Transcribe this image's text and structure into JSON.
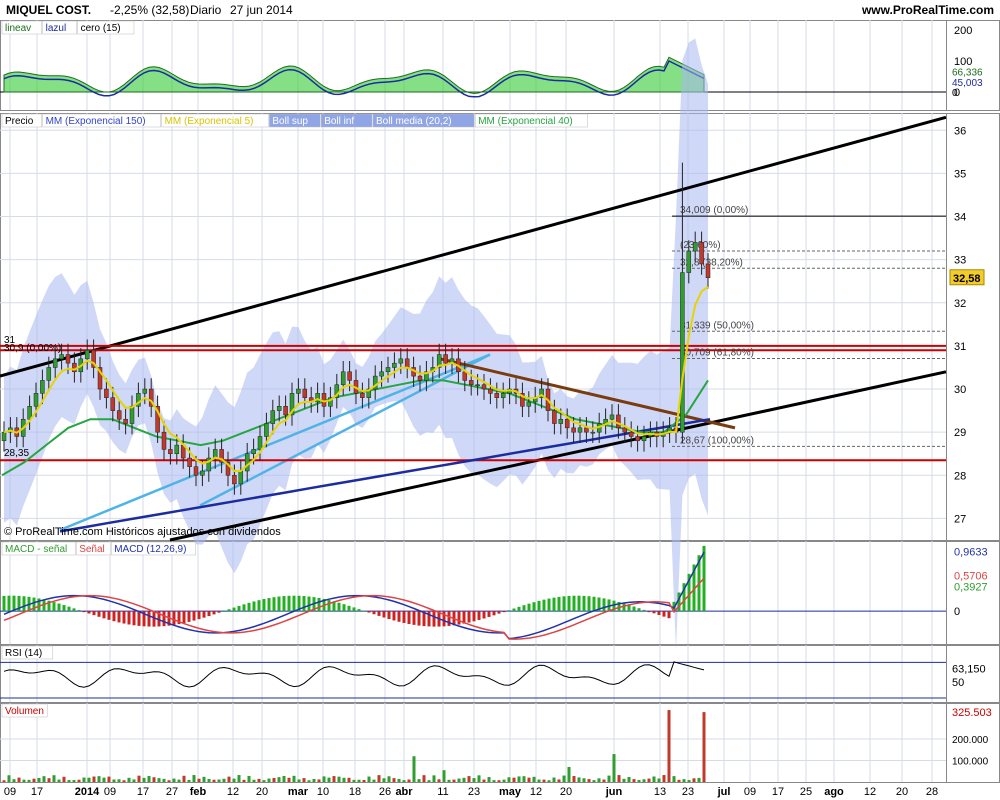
{
  "header": {
    "title": "MIQUEL COST.",
    "change": "-2,25% (32,58)",
    "period": "Diario",
    "date": "27 jun 2014",
    "site": "www.ProRealTime.com"
  },
  "copyright": "© ProRealTime.com  Históricos ajustados con dividendos",
  "colors": {
    "grid": "#d6dce6",
    "axis_bg": "#ffffff",
    "up_candle": "#2f9e2f",
    "down_candle": "#c0392b",
    "black": "#000000",
    "red_line": "#cc0000",
    "brown_line": "#7a3b0f",
    "light_blue": "#4fb3e8",
    "navy": "#1c2ca0",
    "green_ma": "#26a641",
    "yellow_ma": "#e6d400",
    "boll_fill": "#a9b8f0",
    "macd_line": "#2233aa",
    "signal_line": "#dd4444",
    "hist_up": "#22b022",
    "hist_down": "#cc2222",
    "osc_fill": "#33cc33"
  },
  "x_axis": {
    "ticks": [
      "09",
      "17",
      "2014",
      "09",
      "17",
      "27",
      "feb",
      "12",
      "20",
      "mar",
      "10",
      "18",
      "26",
      "abr",
      "11",
      "23",
      "may",
      "12",
      "20",
      "jun",
      "13",
      "23",
      "jul",
      "09",
      "17",
      "25",
      "ago",
      "12",
      "20",
      "28"
    ]
  },
  "panels": {
    "oscillator": {
      "legend": [
        {
          "label": "lineav",
          "color": "#1c6d1c"
        },
        {
          "label": "lazul",
          "color": "#1c2ca0"
        },
        {
          "label": "cero (15)",
          "color": "#000000"
        }
      ],
      "axis_labels": [
        "200",
        "100",
        "0"
      ],
      "value_tags": [
        {
          "label": "66,336",
          "color": "#1c6d1c"
        },
        {
          "label": "45,003",
          "color": "#1c2ca0"
        },
        {
          "label": "0",
          "color": "#000000"
        }
      ]
    },
    "price": {
      "legend": [
        {
          "label": "Precio",
          "color": "#000000",
          "bg": "#ffffff"
        },
        {
          "label": "MM (Exponencial 150)",
          "color": "#3344cc",
          "bg": "#ffffff"
        },
        {
          "label": "MM (Exponencial 5)",
          "color": "#d8c400",
          "bg": "#ffffff"
        },
        {
          "label": "Boll sup",
          "color": "#ffffff",
          "bg": "#8fa5e6"
        },
        {
          "label": "Boll inf",
          "color": "#ffffff",
          "bg": "#8fa5e6"
        },
        {
          "label": "Boll media (20,2)",
          "color": "#ffffff",
          "bg": "#8fa5e6"
        },
        {
          "label": "MM (Exponencial 40)",
          "color": "#26a641",
          "bg": "#ffffff"
        }
      ],
      "axis_labels": [
        "36",
        "35",
        "34",
        "33",
        "32",
        "31",
        "30",
        "29",
        "28",
        "27"
      ],
      "last_price_tag": "32,58",
      "line_labels": [
        {
          "label": "31",
          "kind": "resistance"
        },
        {
          "label": "30,9 (0,00%)",
          "kind": "fib"
        },
        {
          "label": "28,35",
          "kind": "support"
        }
      ],
      "fibonacci": [
        {
          "label": "34,009 (0,00%)"
        },
        {
          "label": "(23,60%)"
        },
        {
          "label": "32,8 (38,20%)"
        },
        {
          "label": "31,339 (50,00%)"
        },
        {
          "label": "30,709 (61,80%)"
        },
        {
          "label": "28,67 (100,00%)"
        }
      ]
    },
    "macd": {
      "legend": [
        {
          "label": "MACD - señal",
          "color": "#2f9e2f"
        },
        {
          "label": "Señal",
          "color": "#dd4444"
        },
        {
          "label": "MACD (12,26,9)",
          "color": "#2233aa"
        }
      ],
      "value_tags": [
        {
          "label": "0,9633",
          "color": "#2233aa"
        },
        {
          "label": "0,5706",
          "color": "#dd4444"
        },
        {
          "label": "0,3927",
          "color": "#2f9e2f"
        },
        {
          "label": "0",
          "color": "#000000"
        }
      ]
    },
    "rsi": {
      "legend": [
        {
          "label": "RSI (14)",
          "color": "#000000"
        }
      ],
      "value_tags": [
        {
          "label": "63,150",
          "color": "#000000"
        },
        {
          "label": "50",
          "color": "#000000"
        }
      ]
    },
    "volume": {
      "legend": [
        {
          "label": "Volumen",
          "color": "#cc0000"
        }
      ],
      "axis_labels": [
        "200.000",
        "100.000"
      ],
      "value_tag": "325.503"
    }
  },
  "chart_data": {
    "type": "candlestick",
    "title": "MIQUEL COST.",
    "period": "Diario",
    "ylim": [
      26.5,
      36.4
    ],
    "close_series": [
      29,
      29.1,
      28.9,
      29.3,
      29.6,
      29.9,
      30.2,
      30.5,
      30.7,
      30.8,
      30.6,
      30.4,
      30.7,
      30.9,
      30.5,
      30,
      29.8,
      29.5,
      29.3,
      29.2,
      29.6,
      29.9,
      30,
      29.6,
      29,
      28.6,
      28.5,
      28.7,
      28.4,
      28.2,
      28,
      28.1,
      28.4,
      28.6,
      28.3,
      28,
      27.8,
      28.1,
      28.5,
      28.6,
      28.9,
      29.2,
      29.5,
      29.6,
      29.4,
      29.9,
      30,
      29.8,
      29.7,
      29.9,
      29.6,
      29.8,
      30.1,
      30.4,
      30.2,
      29.9,
      29.8,
      30,
      30.3,
      30.4,
      30.5,
      30.6,
      30.7,
      30.5,
      30.3,
      30.2,
      30.4,
      30.5,
      30.8,
      30.6,
      30.7,
      30.4,
      30.2,
      30.1,
      30.1,
      30,
      29.9,
      29.8,
      29.9,
      30,
      29.9,
      29.6,
      29.7,
      29.8,
      30,
      29.5,
      29.2,
      29.3,
      29.1,
      29,
      29.1,
      29,
      29,
      29.2,
      29.3,
      29.4,
      29.1,
      29,
      28.9,
      28.8,
      28.9,
      29,
      28.9,
      29,
      29.1,
      29,
      32.7,
      33.2,
      33.4,
      32.9,
      32.58
    ],
    "exp_ma_150": [
      26.7,
      26.8,
      26.9,
      27,
      27.1,
      27.2,
      27.3,
      27.4,
      27.5,
      27.6,
      27.7,
      27.8,
      27.9,
      28,
      28.1,
      28.2,
      28.3,
      28.4,
      28.5,
      28.6,
      28.7,
      28.8,
      28.9,
      29,
      29.1,
      29.2,
      29.3
    ],
    "exp_ma_40": [
      28,
      28.3,
      28.7,
      29.1,
      29.3,
      29.3,
      29.1,
      28.9,
      28.8,
      28.7,
      28.8,
      29,
      29.2,
      29.4,
      29.6,
      29.8,
      29.9,
      30,
      30.1,
      30.2,
      30.2,
      30.1,
      30,
      29.9,
      29.7,
      29.5,
      29.3,
      29.2,
      29.1,
      29,
      29,
      29.4,
      30.2
    ],
    "horizontal_lines": [
      31,
      30.9,
      28.35
    ],
    "fibonacci_levels": [
      34.009,
      33.2,
      32.8,
      31.339,
      30.709,
      28.67
    ],
    "volume_last": 325503,
    "rsi_last": 63.15,
    "macd": {
      "macd": 0.9633,
      "signal": 0.5706,
      "histogram": 0.3927
    },
    "oscillator_last": {
      "lineav": 66.336,
      "lazul": 45.003
    }
  }
}
